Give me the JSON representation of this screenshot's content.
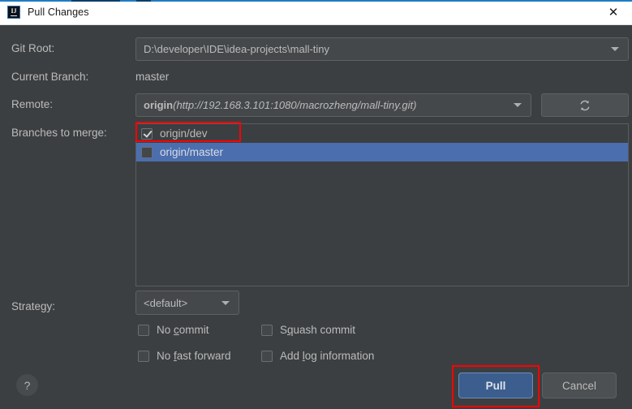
{
  "window": {
    "title": "Pull Changes",
    "app_icon": "intellij-idea-icon",
    "close_icon": "close-icon"
  },
  "form": {
    "git_root": {
      "label": "Git Root:",
      "value": "D:\\developer\\IDE\\idea-projects\\mall-tiny"
    },
    "current_branch": {
      "label": "Current Branch:",
      "value": "master"
    },
    "remote": {
      "label": "Remote:",
      "name": "origin",
      "url": "(http://192.168.3.101:1080/macrozheng/mall-tiny.git)",
      "refresh_icon": "refresh-icon"
    },
    "branches": {
      "label": "Branches to merge:",
      "items": [
        {
          "name": "origin/dev",
          "checked": true,
          "selected": false
        },
        {
          "name": "origin/master",
          "checked": false,
          "selected": true
        }
      ]
    },
    "strategy": {
      "label": "Strategy:",
      "value": "<default>"
    },
    "options": [
      {
        "pre": "No ",
        "mnemonic": "c",
        "post": "ommit",
        "checked": false
      },
      {
        "pre": "S",
        "mnemonic": "q",
        "post": "uash commit",
        "checked": false
      },
      {
        "pre": "No ",
        "mnemonic": "f",
        "post": "ast forward",
        "checked": false
      },
      {
        "pre": "Add ",
        "mnemonic": "l",
        "post": "og information",
        "checked": false
      }
    ]
  },
  "footer": {
    "help_label": "?",
    "pull_label": "Pull",
    "cancel_label": "Cancel"
  },
  "colors": {
    "dialog_bg": "#3c3f41",
    "selection_blue": "#4b6eaf",
    "default_button": "#3c5e8f",
    "annotation_red": "#ff0000",
    "text": "#bbbbbb"
  }
}
